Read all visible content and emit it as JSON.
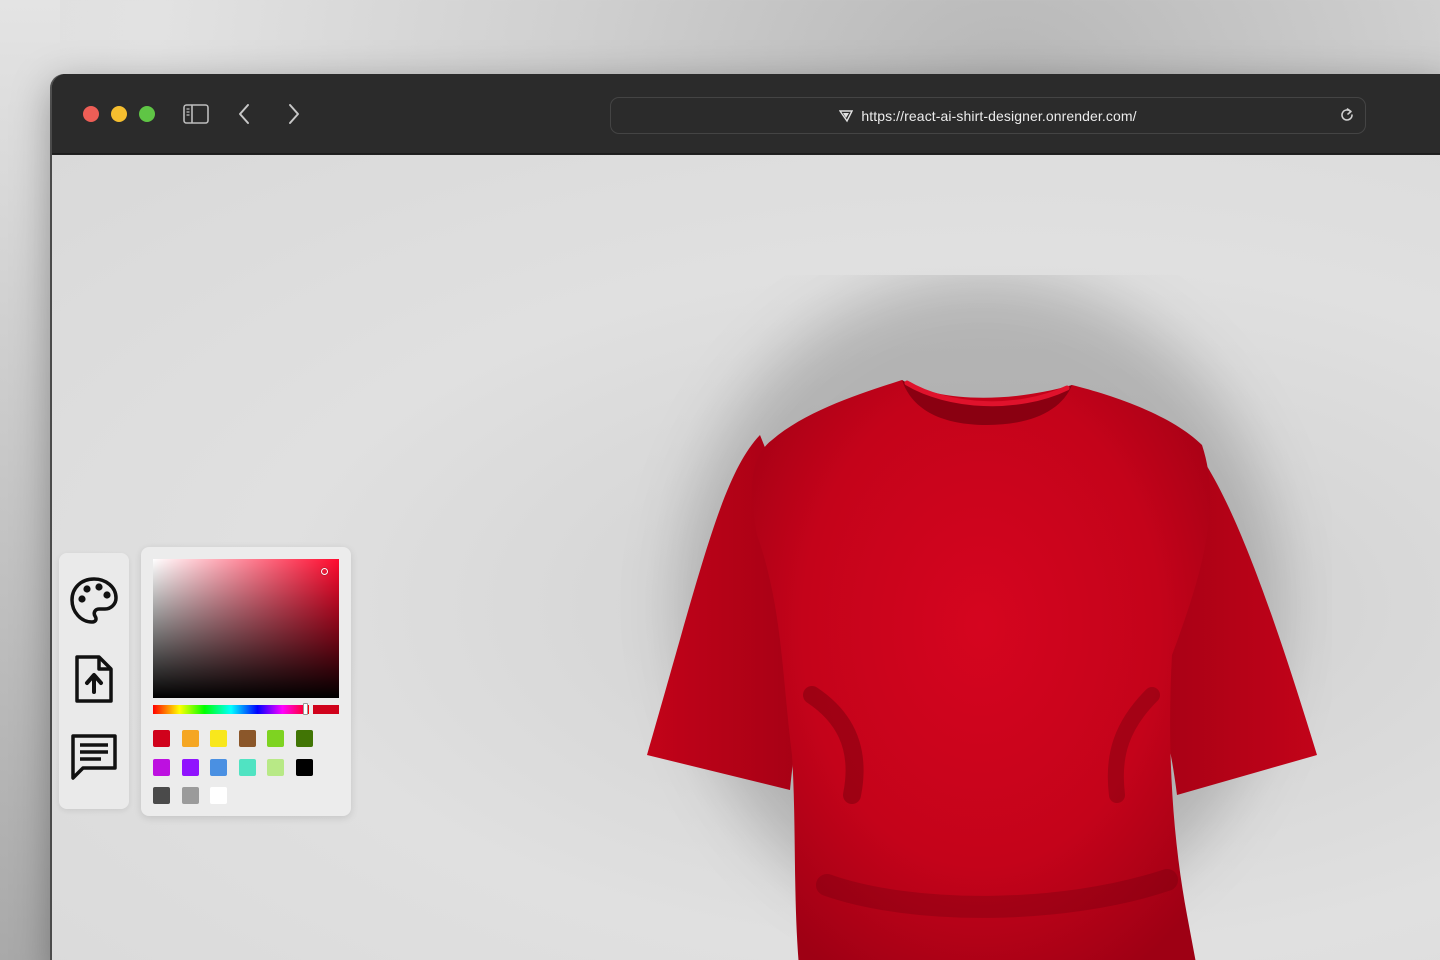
{
  "browser": {
    "url": "https://react-ai-shirt-designer.onrender.com/",
    "icons": {
      "close": "close-traffic-light",
      "minimize": "minimize-traffic-light",
      "zoom": "zoom-traffic-light",
      "sidebar": "sidebar-toggle-icon",
      "back": "chevron-left-icon",
      "forward": "chevron-right-icon",
      "favicon": "shield-icon",
      "reload": "reload-icon"
    }
  },
  "app": {
    "shirt_color": "#d0021b",
    "tools": [
      {
        "name": "color-picker",
        "icon": "palette-icon"
      },
      {
        "name": "file-upload",
        "icon": "file-upload-icon"
      },
      {
        "name": "ai-prompt",
        "icon": "chat-icon"
      }
    ],
    "picker": {
      "selected_color": "#d0021b",
      "hue_color": "#ff0a2e",
      "swatches": [
        "#d0021b",
        "#f5a623",
        "#f8e71c",
        "#8b572a",
        "#7ed321",
        "#417505",
        "#bd10e0",
        "#9013fe",
        "#4a90e2",
        "#50e3c2",
        "#b8e986",
        "#000000",
        "#4a4a4a",
        "#9b9b9b",
        "#ffffff"
      ]
    }
  }
}
